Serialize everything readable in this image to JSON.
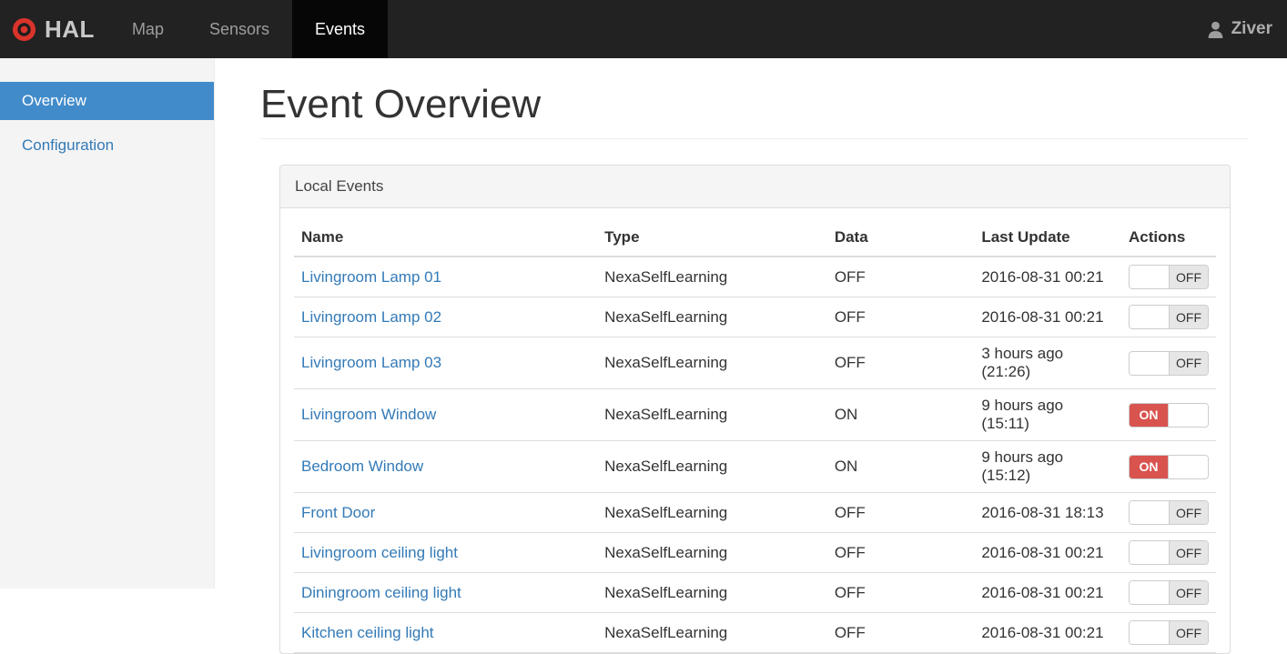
{
  "navbar": {
    "brand": "HAL",
    "items": [
      {
        "label": "Map",
        "active": false
      },
      {
        "label": "Sensors",
        "active": false
      },
      {
        "label": "Events",
        "active": true
      }
    ],
    "user": {
      "name": "Ziver"
    }
  },
  "sidebar": {
    "items": [
      {
        "label": "Overview",
        "active": true
      },
      {
        "label": "Configuration",
        "active": false
      }
    ]
  },
  "main": {
    "title": "Event Overview",
    "panel": {
      "title": "Local Events",
      "table": {
        "columns": [
          "Name",
          "Type",
          "Data",
          "Last Update",
          "Actions"
        ],
        "toggle_labels": {
          "on": "ON",
          "off": "OFF"
        },
        "rows": [
          {
            "name": "Livingroom Lamp 01",
            "type": "NexaSelfLearning",
            "data": "OFF",
            "last_update": "2016-08-31 00:21",
            "state": "off"
          },
          {
            "name": "Livingroom Lamp 02",
            "type": "NexaSelfLearning",
            "data": "OFF",
            "last_update": "2016-08-31 00:21",
            "state": "off"
          },
          {
            "name": "Livingroom Lamp 03",
            "type": "NexaSelfLearning",
            "data": "OFF",
            "last_update": "3 hours ago (21:26)",
            "state": "off"
          },
          {
            "name": "Livingroom Window",
            "type": "NexaSelfLearning",
            "data": "ON",
            "last_update": "9 hours ago (15:11)",
            "state": "on"
          },
          {
            "name": "Bedroom Window",
            "type": "NexaSelfLearning",
            "data": "ON",
            "last_update": "9 hours ago (15:12)",
            "state": "on"
          },
          {
            "name": "Front Door",
            "type": "NexaSelfLearning",
            "data": "OFF",
            "last_update": "2016-08-31 18:13",
            "state": "off"
          },
          {
            "name": "Livingroom ceiling light",
            "type": "NexaSelfLearning",
            "data": "OFF",
            "last_update": "2016-08-31 00:21",
            "state": "off"
          },
          {
            "name": "Diningroom ceiling light",
            "type": "NexaSelfLearning",
            "data": "OFF",
            "last_update": "2016-08-31 00:21",
            "state": "off"
          },
          {
            "name": "Kitchen ceiling light",
            "type": "NexaSelfLearning",
            "data": "OFF",
            "last_update": "2016-08-31 00:21",
            "state": "off"
          }
        ]
      }
    }
  },
  "colors": {
    "navbar_bg": "#222222",
    "navbar_active_bg": "#060606",
    "brand_red": "#d9342b",
    "sidebar_bg": "#f4f4f4",
    "sidebar_active_bg": "#428bca",
    "link_blue": "#337ab7",
    "toggle_on_red": "#d9534f",
    "toggle_off_gray": "#e6e6e6"
  }
}
